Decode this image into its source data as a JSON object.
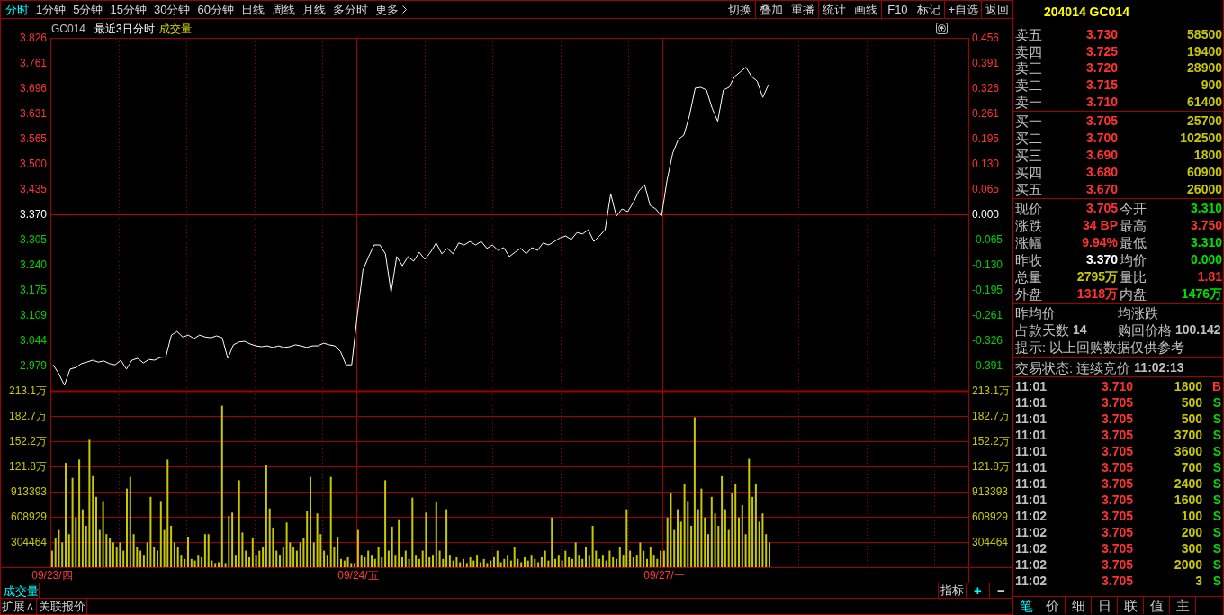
{
  "toolbar": {
    "periods": [
      {
        "label": "分时",
        "selected": true
      },
      {
        "label": "1分钟",
        "selected": false
      },
      {
        "label": "5分钟",
        "selected": false
      },
      {
        "label": "15分钟",
        "selected": false
      },
      {
        "label": "30分钟",
        "selected": false
      },
      {
        "label": "60分钟",
        "selected": false
      },
      {
        "label": "日线",
        "selected": false
      },
      {
        "label": "周线",
        "selected": false
      },
      {
        "label": "月线",
        "selected": false
      },
      {
        "label": "多分时",
        "selected": false
      }
    ],
    "more": "更多",
    "actions": [
      "切换",
      "叠加",
      "重播",
      "统计",
      "画线",
      "F10",
      "标记",
      "+自选",
      "返回"
    ]
  },
  "chart": {
    "header": {
      "code": "GC014",
      "title": "最近3日分时",
      "indicator": "成交量"
    },
    "price_panel": {
      "chart_data": {
        "type": "line",
        "grid": true,
        "categories": [
          null,
          null,
          null,
          null,
          null,
          null,
          null,
          null,
          null,
          null,
          null,
          null,
          null,
          null,
          null,
          null,
          null,
          null,
          null,
          null,
          null,
          null,
          null,
          null,
          null,
          null,
          null,
          null,
          null,
          null,
          null,
          null,
          null,
          null,
          null,
          null,
          null,
          null,
          null,
          null,
          null,
          null,
          null,
          null,
          null,
          null,
          null,
          null,
          null,
          null,
          null,
          null,
          null,
          null,
          null,
          null,
          null,
          null,
          null,
          null,
          null,
          null,
          null,
          null,
          null,
          null,
          null,
          null,
          null,
          null,
          null,
          null,
          null,
          null,
          null,
          null,
          null,
          null,
          null,
          null,
          null,
          null,
          null,
          null,
          null,
          null,
          null,
          null,
          null,
          null,
          null,
          null,
          null,
          null,
          null,
          null,
          null,
          null,
          null,
          null,
          null,
          null,
          null,
          null,
          null,
          null,
          null,
          null,
          null,
          null,
          null,
          null,
          null,
          null,
          null,
          null,
          null,
          null,
          null,
          null,
          null,
          null,
          null,
          null,
          null,
          null,
          null,
          null,
          null,
          null,
          null,
          null,
          null,
          null,
          null,
          null,
          null,
          null,
          null,
          null,
          null,
          null,
          null,
          null,
          null,
          null,
          null,
          null,
          null,
          null,
          null,
          null,
          null,
          null,
          null,
          null,
          null,
          null,
          null,
          null,
          null,
          null,
          null
        ],
        "ylim": [
          2.914,
          3.826
        ],
        "yticks": [
          {
            "value": 3.826,
            "label": "3.826"
          },
          {
            "value": 3.761,
            "label": "3.761"
          },
          {
            "value": 3.696,
            "label": "3.696"
          },
          {
            "value": 3.631,
            "label": "3.631"
          },
          {
            "value": 3.565,
            "label": "3.565"
          },
          {
            "value": 3.5,
            "label": "3.500"
          },
          {
            "value": 3.435,
            "label": "3.435"
          },
          {
            "value": 3.37,
            "label": "3.370"
          },
          {
            "value": 3.305,
            "label": "3.305"
          },
          {
            "value": 3.24,
            "label": "3.240"
          },
          {
            "value": 3.175,
            "label": "3.175"
          },
          {
            "value": 3.109,
            "label": "3.109"
          },
          {
            "value": 3.044,
            "label": "3.044"
          },
          {
            "value": 2.979,
            "label": "2.979"
          }
        ],
        "series": [
          {
            "color": "#ffffff",
            "values": [
              2.981,
              2.958,
              2.928,
              2.97,
              2.974,
              2.984,
              2.988,
              2.993,
              2.988,
              2.991,
              2.984,
              2.981,
              2.993,
              2.97,
              2.993,
              2.998,
              2.986,
              2.995,
              2.993,
              3.0,
              3.002,
              3.058,
              3.067,
              3.053,
              3.058,
              3.049,
              3.058,
              3.053,
              3.051,
              3.056,
              3.051,
              2.998,
              3.033,
              3.04,
              3.042,
              3.035,
              3.03,
              3.028,
              3.03,
              3.026,
              3.03,
              3.026,
              3.028,
              3.033,
              3.03,
              3.026,
              3.03,
              3.03,
              3.037,
              3.033,
              3.03,
              3.016,
              2.981,
              2.981,
              3.109,
              3.226,
              3.261,
              3.291,
              3.291,
              3.268,
              3.168,
              3.261,
              3.237,
              3.261,
              3.249,
              3.272,
              3.254,
              3.272,
              3.296,
              3.268,
              3.282,
              3.268,
              3.296,
              3.291,
              3.3,
              3.291,
              3.3,
              3.282,
              3.291,
              3.277,
              3.284,
              3.261,
              3.272,
              3.282,
              3.268,
              3.284,
              3.277,
              3.296,
              3.291,
              3.3,
              3.309,
              3.314,
              3.305,
              3.323,
              3.319,
              3.33,
              3.3,
              3.314,
              3.33,
              3.423,
              3.365,
              3.384,
              3.377,
              3.4,
              3.43,
              3.447,
              3.393,
              3.384,
              3.365,
              3.458,
              3.528,
              3.563,
              3.575,
              3.626,
              3.696,
              3.698,
              3.691,
              3.644,
              3.61,
              3.691,
              3.698,
              3.726,
              3.738,
              3.75,
              3.726,
              3.714,
              3.672,
              3.705,
              null,
              null,
              null,
              null,
              null,
              null,
              null,
              null,
              null,
              null,
              null,
              null,
              null,
              null,
              null,
              null,
              null,
              null,
              null,
              null,
              null,
              null,
              null,
              null,
              null,
              null,
              null,
              null,
              null,
              null,
              null,
              null,
              null,
              null,
              null
            ]
          }
        ],
        "ref_lines": [
          {
            "axis": "y",
            "value": 3.37
          }
        ]
      },
      "right_axis_labels": [
        "0.456",
        "0.391",
        "0.326",
        "0.261",
        "0.195",
        "0.130",
        "0.065",
        "0.000",
        "-0.065",
        "-0.130",
        "-0.195",
        "-0.261",
        "-0.326",
        "-0.391"
      ]
    },
    "volume_panel": {
      "upper_axis_labels": [
        "213.1万",
        "182.7万",
        "152.2万",
        "121.8万"
      ],
      "chart_data": {
        "type": "bar",
        "grid": true,
        "categories": [
          "09/23/四",
          null,
          null,
          null,
          null,
          null,
          null,
          null,
          null,
          null,
          null,
          null,
          null,
          null,
          null,
          null,
          null,
          null,
          null,
          null,
          null,
          null,
          null,
          null,
          null,
          null,
          null,
          null,
          null,
          null,
          null,
          null,
          null,
          null,
          null,
          null,
          null,
          null,
          null,
          null,
          null,
          null,
          null,
          null,
          null,
          null,
          null,
          null,
          null,
          null,
          null,
          null,
          null,
          null,
          null,
          null,
          null,
          null,
          null,
          null,
          null,
          null,
          null,
          null,
          null,
          null,
          null,
          null,
          null,
          null,
          null,
          null,
          null,
          null,
          null,
          null,
          null,
          null,
          null,
          null,
          null,
          null,
          null,
          null,
          null,
          null,
          null,
          null,
          null,
          null,
          "09/24/五",
          null,
          null,
          null,
          null,
          null,
          null,
          null,
          null,
          null,
          null,
          null,
          null,
          null,
          null,
          null,
          null,
          null,
          null,
          null,
          null,
          null,
          null,
          null,
          null,
          null,
          null,
          null,
          null,
          null,
          null,
          null,
          null,
          null,
          null,
          null,
          null,
          null,
          null,
          null,
          null,
          null,
          null,
          null,
          null,
          null,
          null,
          null,
          null,
          null,
          null,
          null,
          null,
          null,
          null,
          null,
          null,
          null,
          null,
          null,
          null,
          null,
          null,
          null,
          null,
          null,
          null,
          null,
          null,
          null,
          null,
          null,
          null,
          null,
          null,
          null,
          null,
          null,
          null,
          null,
          null,
          null,
          null,
          null,
          null,
          null,
          null,
          null,
          null,
          null,
          "09/27/一",
          null,
          null,
          null,
          null,
          null,
          null,
          null,
          null,
          null,
          null,
          null,
          null,
          null,
          null,
          null,
          null,
          null,
          null,
          null,
          null,
          null,
          null,
          null,
          null,
          null,
          null,
          null,
          null,
          null,
          null,
          null,
          null,
          null,
          null,
          null,
          null,
          null,
          null,
          null,
          null,
          null,
          null,
          null,
          null,
          null,
          null,
          null,
          null,
          null,
          null,
          null,
          null,
          null,
          null,
          null,
          null,
          null,
          null,
          null,
          null,
          null,
          null,
          null,
          null,
          null,
          null,
          null,
          null,
          null,
          null,
          null,
          null,
          null,
          null,
          null,
          null,
          null,
          null,
          null,
          null,
          null,
          null,
          null,
          null,
          null,
          null,
          null,
          null,
          null
        ],
        "ylim": [
          0,
          2131000
        ],
        "yticks": [
          {
            "value": 913393,
            "label": "913393"
          },
          {
            "value": 608929,
            "label": "608929"
          },
          {
            "value": 304464,
            "label": "304464"
          }
        ],
        "series": [
          {
            "color": "#c8c800",
            "values": [
              200000,
              350000,
              450000,
              300000,
              1260000,
              400000,
              1080000,
              600000,
              1300000,
              700000,
              500000,
              1540000,
              1100000,
              850000,
              450000,
              800000,
              400000,
              350000,
              300000,
              250000,
              300000,
              200000,
              950000,
              1090000,
              400000,
              250000,
              200000,
              150000,
              300000,
              850000,
              250000,
              200000,
              800000,
              450000,
              1300000,
              500000,
              300000,
              250000,
              150000,
              100000,
              370000,
              100000,
              80000,
              150000,
              120000,
              400000,
              400000,
              80000,
              50000,
              60000,
              1950000,
              50000,
              620000,
              660000,
              150000,
              1050000,
              420000,
              200000,
              120000,
              360000,
              150000,
              200000,
              250000,
              1240000,
              710000,
              480000,
              200000,
              150000,
              250000,
              540000,
              300000,
              250000,
              200000,
              300000,
              350000,
              680000,
              1090000,
              300000,
              650000,
              400000,
              200000,
              150000,
              1090000,
              250000,
              370000,
              100000,
              80000,
              120000,
              50000,
              50000,
              450000,
              150000,
              120000,
              200000,
              150000,
              100000,
              250000,
              120000,
              1050000,
              200000,
              490000,
              150000,
              580000,
              120000,
              200000,
              100000,
              840000,
              150000,
              100000,
              200000,
              660000,
              120000,
              150000,
              790000,
              200000,
              100000,
              700000,
              150000,
              80000,
              120000,
              60000,
              100000,
              50000,
              120000,
              80000,
              150000,
              60000,
              100000,
              50000,
              80000,
              120000,
              200000,
              60000,
              100000,
              150000,
              80000,
              250000,
              100000,
              60000,
              120000,
              80000,
              150000,
              100000,
              60000,
              120000,
              200000,
              80000,
              600000,
              100000,
              150000,
              80000,
              200000,
              120000,
              100000,
              300000,
              150000,
              100000,
              250000,
              150000,
              500000,
              200000,
              100000,
              150000,
              80000,
              200000,
              120000,
              100000,
              250000,
              150000,
              700000,
              200000,
              120000,
              150000,
              300000,
              200000,
              100000,
              250000,
              150000,
              100000,
              200000,
              200000,
              600000,
              900000,
              450000,
              700000,
              550000,
              1000000,
              800000,
              500000,
              1810000,
              700000,
              950000,
              600000,
              400000,
              850000,
              650000,
              500000,
              1100000,
              700000,
              450000,
              900000,
              1000000,
              600000,
              750000,
              400000,
              1310000,
              850000,
              1000000,
              550000,
              650000,
              400000,
              300000,
              null,
              null,
              null,
              null,
              null,
              null,
              null,
              null,
              null,
              null,
              null,
              null,
              null,
              null,
              null,
              null,
              null,
              null,
              null,
              null,
              null,
              null,
              null,
              null,
              null,
              null,
              null,
              null,
              null,
              null,
              null,
              null,
              null,
              null,
              null,
              null,
              null,
              null,
              null,
              null,
              null,
              null,
              null,
              null,
              null,
              null,
              null,
              null,
              null,
              null,
              null,
              null,
              null,
              null,
              null,
              null,
              null,
              null
            ]
          }
        ]
      },
      "right_axis_labels": [
        "213.1万",
        "182.7万",
        "152.2万",
        "121.8万",
        "913393",
        "608929",
        "304464"
      ]
    },
    "indicator_bar": {
      "label": "成交量",
      "buttons": [
        {
          "label": "指标",
          "color": "#d8d8d8"
        },
        {
          "label": "+",
          "color": "#00ffff"
        },
        {
          "label": "−",
          "color": "#d8d8d8"
        }
      ]
    }
  },
  "bottom_bar": {
    "tabs": [
      "扩展∧",
      "关联报价"
    ]
  },
  "quote_panel": {
    "title": "204014 GC014",
    "asks": [
      {
        "label": "卖五",
        "price": "3.730",
        "volume": "58500"
      },
      {
        "label": "卖四",
        "price": "3.725",
        "volume": "19400"
      },
      {
        "label": "卖三",
        "price": "3.720",
        "volume": "28900"
      },
      {
        "label": "卖二",
        "price": "3.715",
        "volume": "900"
      },
      {
        "label": "卖一",
        "price": "3.710",
        "volume": "61400"
      }
    ],
    "bids": [
      {
        "label": "买一",
        "price": "3.705",
        "volume": "25700"
      },
      {
        "label": "买二",
        "price": "3.700",
        "volume": "102500"
      },
      {
        "label": "买三",
        "price": "3.690",
        "volume": "1800"
      },
      {
        "label": "买四",
        "price": "3.680",
        "volume": "60900"
      },
      {
        "label": "买五",
        "price": "3.670",
        "volume": "26000"
      }
    ],
    "stats": [
      {
        "label": "现价",
        "value": "3.705",
        "color": "#ff3232"
      },
      {
        "label": "今开",
        "value": "3.310",
        "color": "#00e000"
      },
      {
        "label": "涨跌",
        "value": "34 BP",
        "color": "#ff3232"
      },
      {
        "label": "最高",
        "value": "3.750",
        "color": "#ff3232"
      },
      {
        "label": "涨幅",
        "value": "9.94%",
        "color": "#ff3232"
      },
      {
        "label": "最低",
        "value": "3.310",
        "color": "#00e000"
      },
      {
        "label": "昨收",
        "value": "3.370",
        "color": "#ffffff"
      },
      {
        "label": "均价",
        "value": "0.000",
        "color": "#00e000"
      },
      {
        "label": "总量",
        "value": "2795万",
        "color": "#c8c800"
      },
      {
        "label": "量比",
        "value": "1.81",
        "color": "#ff3232"
      },
      {
        "label": "外盘",
        "value": "1318万",
        "color": "#ff3232"
      },
      {
        "label": "内盘",
        "value": "1476万",
        "color": "#00e000"
      }
    ],
    "info": [
      {
        "label": "昨均价"
      },
      {
        "label": "均涨跌"
      },
      {
        "label": "占款天数",
        "value": "14"
      },
      {
        "label": "购回价格",
        "value": "100.142"
      }
    ],
    "notice": "提示: 以上回购数据仅供参考",
    "status": {
      "label": "交易状态: 连续竞价",
      "time": "11:02:13"
    },
    "trades": [
      {
        "time": "11:01",
        "price": "3.710",
        "volume": "1800",
        "side": "B",
        "color": "#ff3232"
      },
      {
        "time": "11:01",
        "price": "3.705",
        "volume": "500",
        "side": "S",
        "color": "#00e000"
      },
      {
        "time": "11:01",
        "price": "3.705",
        "volume": "500",
        "side": "S",
        "color": "#00e000"
      },
      {
        "time": "11:01",
        "price": "3.705",
        "volume": "3700",
        "side": "S",
        "color": "#00e000"
      },
      {
        "time": "11:01",
        "price": "3.705",
        "volume": "3600",
        "side": "S",
        "color": "#00e000"
      },
      {
        "time": "11:01",
        "price": "3.705",
        "volume": "700",
        "side": "S",
        "color": "#00e000"
      },
      {
        "time": "11:01",
        "price": "3.705",
        "volume": "2400",
        "side": "S",
        "color": "#00e000"
      },
      {
        "time": "11:01",
        "price": "3.705",
        "volume": "1600",
        "side": "S",
        "color": "#00e000"
      },
      {
        "time": "11:02",
        "price": "3.705",
        "volume": "100",
        "side": "S",
        "color": "#00e000"
      },
      {
        "time": "11:02",
        "price": "3.705",
        "volume": "200",
        "side": "S",
        "color": "#00e000"
      },
      {
        "time": "11:02",
        "price": "3.705",
        "volume": "300",
        "side": "S",
        "color": "#00e000"
      },
      {
        "time": "11:02",
        "price": "3.705",
        "volume": "2000",
        "side": "S",
        "color": "#00e000"
      },
      {
        "time": "11:02",
        "price": "3.705",
        "volume": "3",
        "side": "S",
        "color": "#00e000"
      }
    ],
    "tabs": [
      {
        "label": "笔",
        "selected": true
      },
      {
        "label": "价",
        "selected": false
      },
      {
        "label": "细",
        "selected": false
      },
      {
        "label": "日",
        "selected": false
      },
      {
        "label": "联",
        "selected": false
      },
      {
        "label": "值",
        "selected": false
      },
      {
        "label": "主",
        "selected": false
      }
    ]
  }
}
